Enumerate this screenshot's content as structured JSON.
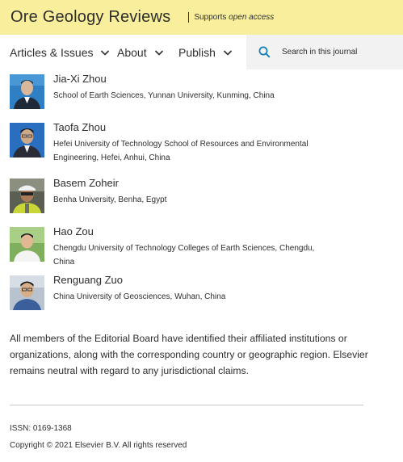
{
  "header": {
    "journal_title": "Ore Geology Reviews",
    "supports_prefix": "Supports ",
    "supports_emph": "open access",
    "background_color": "#f8ee9b"
  },
  "nav": {
    "items": [
      {
        "label": "Articles & Issues",
        "icon": "chevron-down-icon"
      },
      {
        "label": "About",
        "icon": "chevron-down-icon"
      },
      {
        "label": "Publish",
        "icon": "chevron-down-icon"
      }
    ],
    "search": {
      "placeholder": "Search in this journal",
      "icon": "search-icon",
      "accent": "#0c7dbb"
    }
  },
  "members": [
    {
      "name": "Jia-Xi Zhou",
      "affiliation": "School of Earth Sciences, Yunnan University, Kunming, China"
    },
    {
      "name": "Taofa Zhou",
      "affiliation": "Hefei University of Technology School of Resources and Environmental Engineering, Hefei, Anhui, China"
    },
    {
      "name": "Basem Zoheir",
      "affiliation": "Benha University, Benha, Egypt"
    },
    {
      "name": "Hao Zou",
      "affiliation": "Chengdu University of Technology Colleges of Earth Sciences, Chengdu, China"
    },
    {
      "name": "Renguang Zuo",
      "affiliation": "China University of Geosciences, Wuhan, China"
    }
  ],
  "disclaimer": "All members of the Editorial Board have identified their affiliated institutions or organizations, along with the corresponding country or geographic region. Elsevier remains neutral with regard to any jurisdictional claims.",
  "footer": {
    "issn": "ISSN: 0169-1368",
    "copyright": "Copyright © 2021 Elsevier B.V. All rights reserved"
  }
}
